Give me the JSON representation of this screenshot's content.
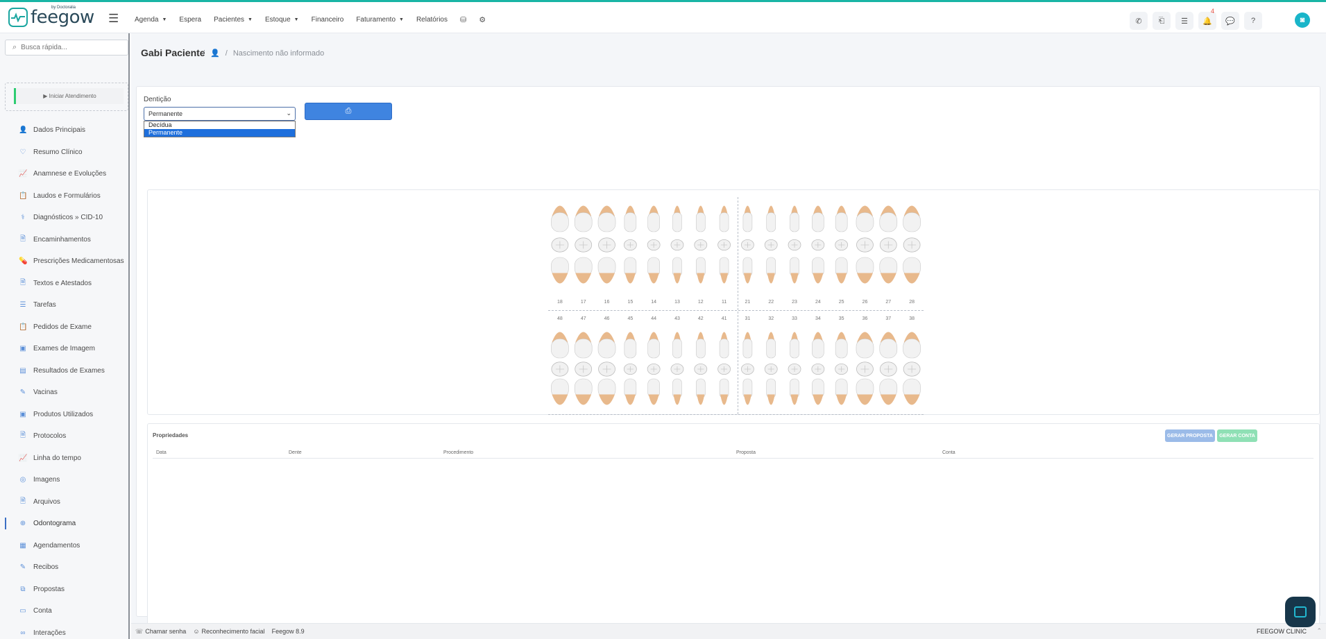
{
  "brand": {
    "name": "feegow",
    "sub": "by Doctoralia"
  },
  "nav": {
    "items": [
      {
        "label": "Agenda",
        "dropdown": true
      },
      {
        "label": "Espera",
        "dropdown": false
      },
      {
        "label": "Pacientes",
        "dropdown": true
      },
      {
        "label": "Estoque",
        "dropdown": true
      },
      {
        "label": "Financeiro",
        "dropdown": false
      },
      {
        "label": "Faturamento",
        "dropdown": true
      },
      {
        "label": "Relatórios",
        "dropdown": false
      }
    ],
    "notification_count": "4"
  },
  "sidebar": {
    "search_placeholder": "Busca rápida...",
    "start_button": "▶ Iniciar Atendimento",
    "items": [
      {
        "label": "Dados Principais",
        "icon": "user-icon",
        "glyph": "👤"
      },
      {
        "label": "Resumo Clínico",
        "icon": "heart-icon",
        "glyph": "♡"
      },
      {
        "label": "Anamnese e Evoluções",
        "icon": "chart-line-icon",
        "glyph": "📈"
      },
      {
        "label": "Laudos e Formulários",
        "icon": "clipboard-icon",
        "glyph": "📋"
      },
      {
        "label": "Diagnósticos » CID-10",
        "icon": "stethoscope-icon",
        "glyph": "⚕"
      },
      {
        "label": "Encaminhamentos",
        "icon": "file-icon",
        "glyph": "🗎"
      },
      {
        "label": "Prescrições Medicamentosas",
        "icon": "pills-icon",
        "glyph": "💊"
      },
      {
        "label": "Textos e Atestados",
        "icon": "document-icon",
        "glyph": "🗎"
      },
      {
        "label": "Tarefas",
        "icon": "list-icon",
        "glyph": "☰"
      },
      {
        "label": "Pedidos de Exame",
        "icon": "clipboard-icon",
        "glyph": "📋"
      },
      {
        "label": "Exames de Imagem",
        "icon": "image-icon",
        "glyph": "▣"
      },
      {
        "label": "Resultados de Exames",
        "icon": "table-icon",
        "glyph": "▤"
      },
      {
        "label": "Vacinas",
        "icon": "syringe-icon",
        "glyph": "✎"
      },
      {
        "label": "Produtos Utilizados",
        "icon": "box-icon",
        "glyph": "▣"
      },
      {
        "label": "Protocolos",
        "icon": "file-icon",
        "glyph": "🗎"
      },
      {
        "label": "Linha do tempo",
        "icon": "chart-line-icon",
        "glyph": "📈"
      },
      {
        "label": "Imagens",
        "icon": "camera-icon",
        "glyph": "◎"
      },
      {
        "label": "Arquivos",
        "icon": "file-icon",
        "glyph": "🗎"
      },
      {
        "label": "Odontograma",
        "icon": "globe-icon",
        "glyph": "⊕",
        "active": true
      },
      {
        "label": "Agendamentos",
        "icon": "calendar-icon",
        "glyph": "▦"
      },
      {
        "label": "Recibos",
        "icon": "edit-icon",
        "glyph": "✎"
      },
      {
        "label": "Propostas",
        "icon": "copy-icon",
        "glyph": "⧉"
      },
      {
        "label": "Conta",
        "icon": "card-icon",
        "glyph": "▭"
      },
      {
        "label": "Interações",
        "icon": "link-icon",
        "glyph": "∞"
      }
    ]
  },
  "patient": {
    "name": "Gabi Paciente",
    "birth": "Nascimento não informado"
  },
  "odontogram": {
    "dentition_label": "Dentição",
    "dentition_value": "Permanente",
    "dentition_options": [
      "Decídua",
      "Permanente"
    ],
    "upper_numbers": [
      "18",
      "17",
      "16",
      "15",
      "14",
      "13",
      "12",
      "11",
      "21",
      "22",
      "23",
      "24",
      "25",
      "26",
      "27",
      "28"
    ],
    "lower_numbers": [
      "48",
      "47",
      "46",
      "45",
      "44",
      "43",
      "42",
      "41",
      "31",
      "32",
      "33",
      "34",
      "35",
      "36",
      "37",
      "38"
    ]
  },
  "properties": {
    "title": "Propriedades",
    "btn_proposal": "GERAR PROPOSTA",
    "btn_account": "GERAR CONTA",
    "columns": [
      "Data",
      "Dente",
      "Procedimento",
      "Proposta",
      "Conta"
    ]
  },
  "footer": {
    "call_password": "Chamar senha",
    "face_recognition": "Reconhecimento facial",
    "version": "Feegow 8.9",
    "clinic": "FEEGOW CLINIC"
  },
  "colors": {
    "accent": "#3f84e0",
    "brand": "#1aa6a0",
    "success": "#2ecc71"
  }
}
